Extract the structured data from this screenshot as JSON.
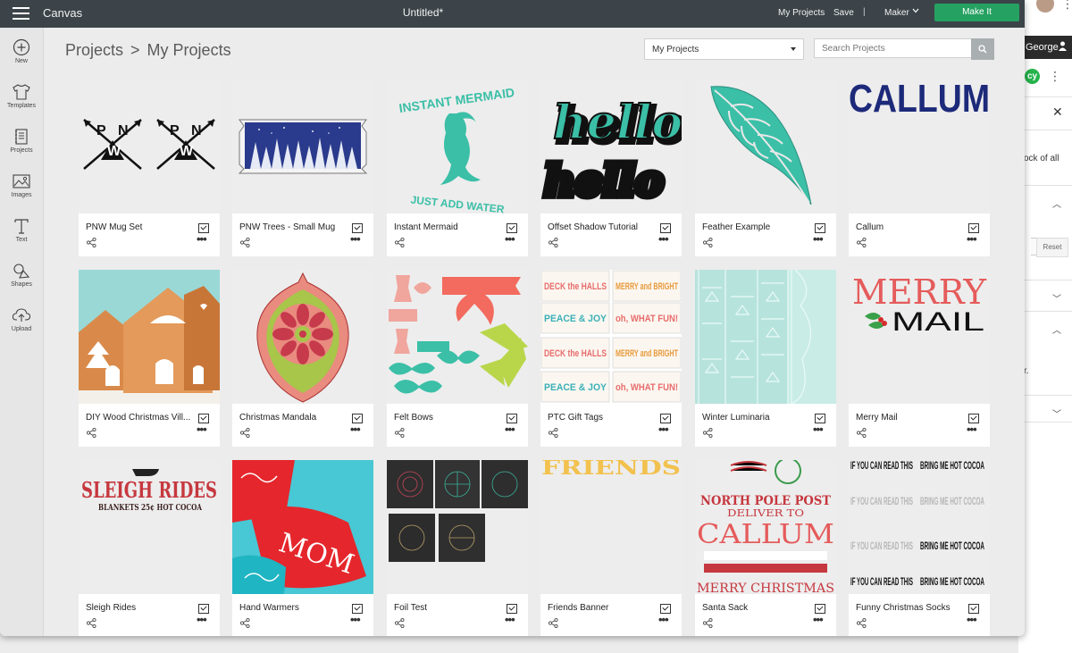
{
  "header": {
    "app_name": "Canvas",
    "doc_title": "Untitled*",
    "my_projects_label": "My Projects",
    "save_label": "Save",
    "separator": "|",
    "machine_label": "Maker",
    "make_it_label": "Make It"
  },
  "sidebar": {
    "items": [
      {
        "label": "New",
        "icon": "plus-circle-icon"
      },
      {
        "label": "Templates",
        "icon": "tshirt-icon"
      },
      {
        "label": "Projects",
        "icon": "projects-icon"
      },
      {
        "label": "Images",
        "icon": "image-icon"
      },
      {
        "label": "Text",
        "icon": "text-icon"
      },
      {
        "label": "Shapes",
        "icon": "shapes-icon"
      },
      {
        "label": "Upload",
        "icon": "upload-cloud-icon"
      }
    ]
  },
  "breadcrumb": {
    "root": "Projects",
    "separator": ">",
    "current": "My Projects"
  },
  "filter": {
    "selected": "My Projects"
  },
  "search": {
    "placeholder": "Search Projects"
  },
  "projects": [
    {
      "name": "PNW Mug Set"
    },
    {
      "name": "PNW Trees - Small Mug"
    },
    {
      "name": "Instant Mermaid",
      "art_top": "INSTANT MERMAID",
      "art_bottom": "JUST ADD WATER"
    },
    {
      "name": "Offset Shadow Tutorial",
      "art_text": "hello"
    },
    {
      "name": "Feather Example"
    },
    {
      "name": "Callum",
      "art_text": "CALLUM"
    },
    {
      "name": "DIY Wood Christmas Vill..."
    },
    {
      "name": "Christmas Mandala"
    },
    {
      "name": "Felt Bows"
    },
    {
      "name": "PTC Gift Tags"
    },
    {
      "name": "Winter Luminaria"
    },
    {
      "name": "Merry Mail",
      "art_top": "MERRY",
      "art_bottom": "MAIL"
    },
    {
      "name": "Sleigh Rides",
      "art_top": "SLEIGH RIDES",
      "art_bottom": "BLANKETS 25¢ HOT COCOA"
    },
    {
      "name": "Hand Warmers",
      "art_text": "MOM"
    },
    {
      "name": "Foil Test"
    },
    {
      "name": "Friends Banner",
      "art_text": "FRIENDS"
    },
    {
      "name": "Santa Sack",
      "art_top": "NORTH POLE POST",
      "art_mid": "DELIVER TO",
      "art_name": "CALLUM",
      "art_bottom": "MERRY CHRISTMAS"
    },
    {
      "name": "Funny Christmas Socks"
    }
  ],
  "ptc_tags": [
    "DECK the HALLS",
    "MERRY and BRIGHT",
    "PEACE & JOY",
    "oh, WHAT FUN!"
  ],
  "sock_words": [
    "IF YOU CAN READ THIS",
    "BRING ME HOT COCOA"
  ],
  "background_window": {
    "user_name": "George",
    "green_badge": "cy",
    "panel_text_1": "ock of all",
    "panel_text_2": "r.",
    "reset_label": "Reset"
  },
  "colors": {
    "header": "#3c4449",
    "make_it": "#25a161",
    "teal": "#3bbfa7",
    "navy": "#1d2a7a",
    "red": "#c6383f"
  }
}
